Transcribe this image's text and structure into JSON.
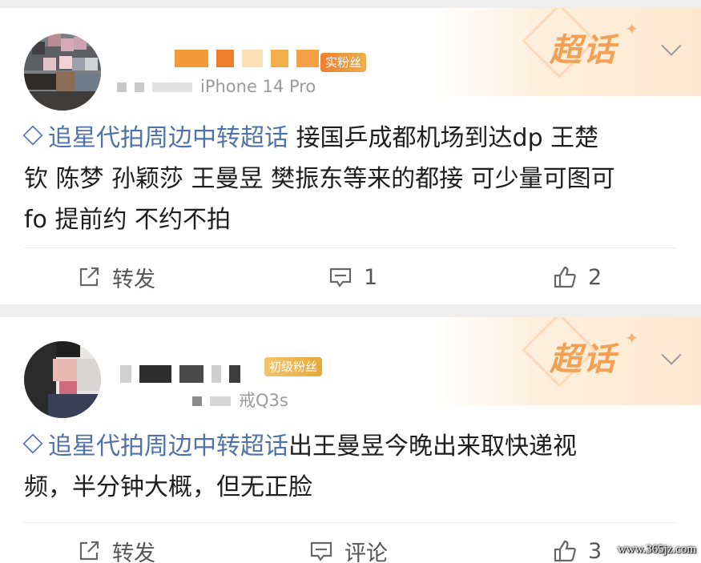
{
  "posts": [
    {
      "topic_badge": "超话",
      "fan_badge": "实粉丝",
      "device": "iPhone 14 Pro",
      "topic": "追星代拍周边中转超话",
      "text_lines": [
        " 接国乒成都机场到达dp 王楚",
        "钦 陈梦 孙颖莎 王曼昱 樊振东等来的都接 可少量可图可",
        "fo 提前约 不约不拍"
      ],
      "actions": {
        "repost_label": "转发",
        "comment_label": "1",
        "like_label": "2"
      }
    },
    {
      "topic_badge": "超话",
      "fan_badge": "初级粉丝",
      "device": "戒Q3s",
      "topic": "追星代拍周边中转超话",
      "text_lines": [
        "出王曼昱今晚出来取快递视",
        "频，半分钟大概，但无正脸"
      ],
      "actions": {
        "repost_label": "转发",
        "comment_label": "评论",
        "like_label": "3"
      }
    }
  ],
  "watermark": "www.365jz.com",
  "colors": {
    "topic_link": "#5072a8",
    "badge_orange": "#f1a054",
    "fan_badge_orange": "#f39a3b",
    "fan_badge_gold": "#e9c25e"
  }
}
